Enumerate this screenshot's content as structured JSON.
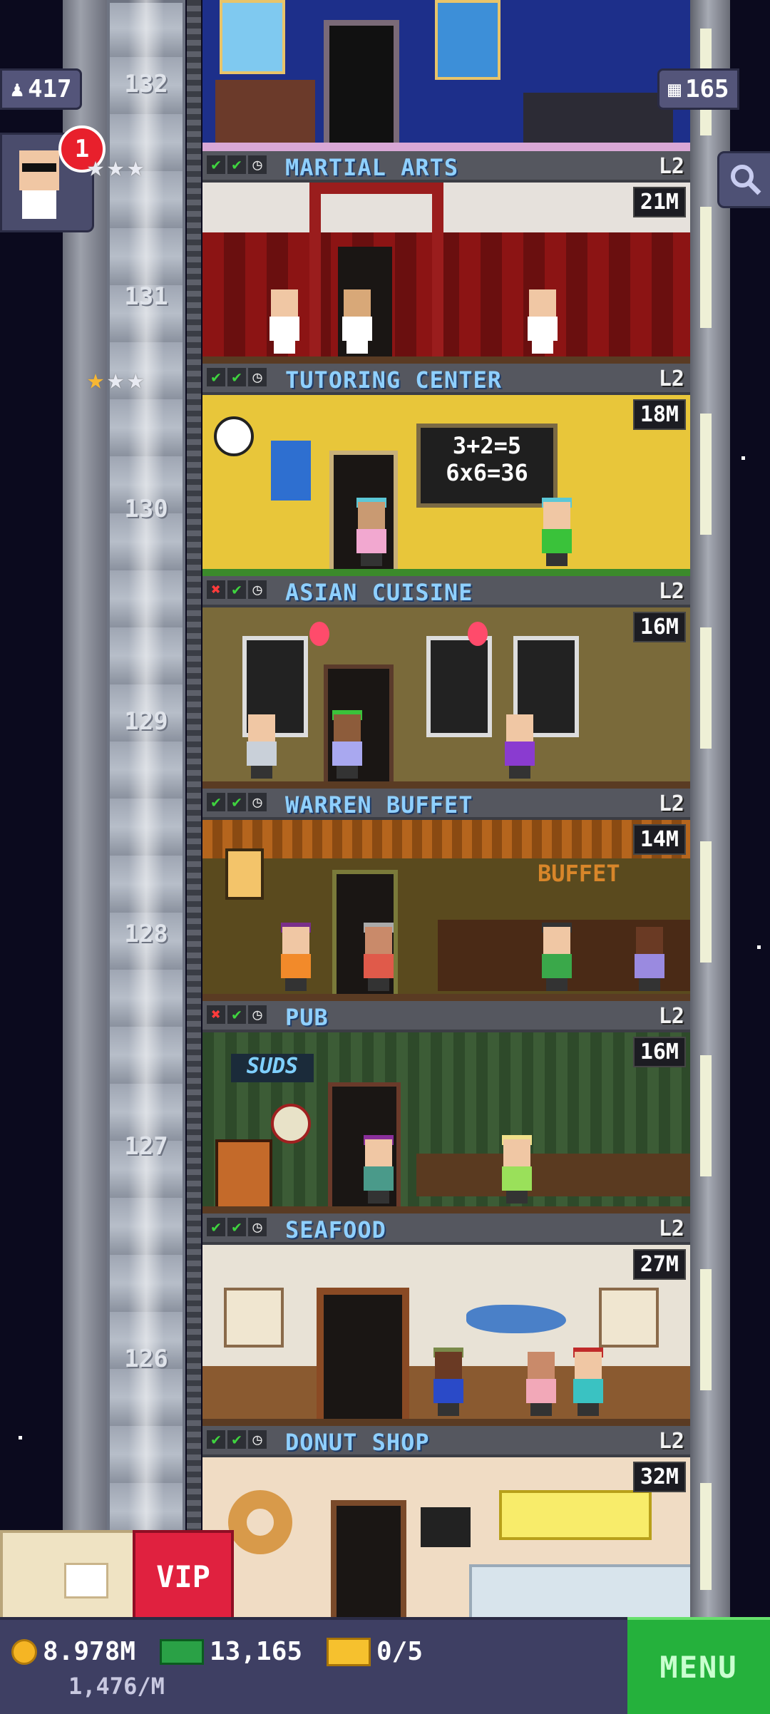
{
  "hud": {
    "population": "417",
    "floors_count": "165",
    "notification_count": "1",
    "top_floor_number": "132"
  },
  "floors": [
    {
      "number": "131",
      "name": "MARTIAL ARTS",
      "level": "L2",
      "income": "21M",
      "status": [
        "check",
        "check",
        "clock"
      ],
      "stars": 3,
      "gold_stars": 0
    },
    {
      "number": "130",
      "name": "TUTORING CENTER",
      "level": "L2",
      "income": "18M",
      "status": [
        "check",
        "check",
        "clock"
      ],
      "stars": 3,
      "gold_stars": 1
    },
    {
      "number": "129",
      "name": "ASIAN CUISINE",
      "level": "L2",
      "income": "16M",
      "status": [
        "x",
        "check",
        "clock"
      ]
    },
    {
      "number": "128",
      "name": "WARREN BUFFET",
      "level": "L2",
      "income": "14M",
      "status": [
        "check",
        "check",
        "clock"
      ]
    },
    {
      "number": "127",
      "name": "PUB",
      "level": "L2",
      "income": "16M",
      "status": [
        "x",
        "check",
        "clock"
      ]
    },
    {
      "number": "126",
      "name": "SEAFOOD",
      "level": "L2",
      "income": "27M",
      "status": [
        "check",
        "check",
        "clock"
      ]
    },
    {
      "number": "",
      "name": "DONUT SHOP",
      "level": "L2",
      "income": "32M",
      "status": [
        "check",
        "check",
        "clock"
      ]
    }
  ],
  "decor_text": {
    "chalkboard_line1": "3+2=5",
    "chalkboard_line2": "6x6=36",
    "buffet_sign": "BUFFET",
    "pub_sign": "SUDS"
  },
  "bottom": {
    "coins": "8.978M",
    "coins_rate": "1,476/M",
    "bux": "13,165",
    "tickets": "0/5",
    "vip_label": "VIP",
    "menu_label": "MENU"
  },
  "colors": {
    "sky": "#0b0a1e",
    "floor_name": "#8fd0ff",
    "menu_green": "#25b13c",
    "vip_red": "#e0213f"
  },
  "icons": [
    "person-icon",
    "grid-icon",
    "search-icon",
    "coin-icon",
    "cash-icon",
    "ticket-icon",
    "chest-icon",
    "check-icon",
    "x-icon",
    "clock-icon",
    "star-icon"
  ]
}
